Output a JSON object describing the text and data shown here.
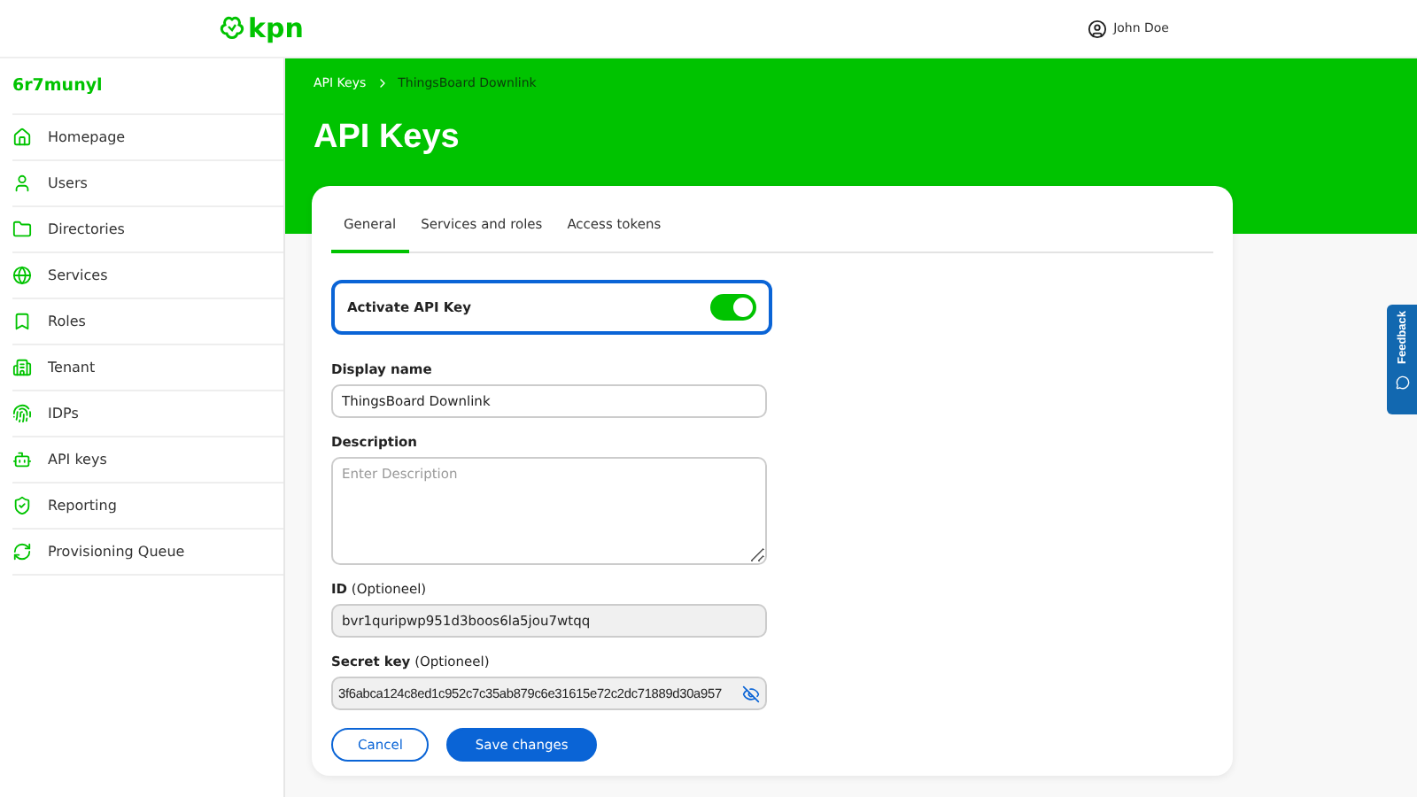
{
  "header": {
    "logo": "kpn",
    "user": "John Doe"
  },
  "sidebar": {
    "title": "6r7munyl",
    "items": [
      {
        "label": "Homepage",
        "selected": false
      },
      {
        "label": "Users",
        "selected": false
      },
      {
        "label": "Directories",
        "selected": false
      },
      {
        "label": "Services",
        "selected": false
      },
      {
        "label": "Roles",
        "selected": false
      },
      {
        "label": "Tenant",
        "selected": false
      },
      {
        "label": "IDPs",
        "selected": false
      },
      {
        "label": "API keys",
        "selected": false
      },
      {
        "label": "Reporting",
        "selected": false
      },
      {
        "label": "Provisioning Queue",
        "selected": false
      }
    ]
  },
  "breadcrumb": [
    {
      "label": "API Keys"
    },
    {
      "label": "ThingsBoard Downlink"
    }
  ],
  "title": "API Keys",
  "tabs": [
    {
      "label": "General",
      "selected": true
    },
    {
      "label": "Services and roles",
      "selected": false
    },
    {
      "label": "Access tokens",
      "selected": false
    }
  ],
  "activate": {
    "label": "Activate API Key",
    "on": true
  },
  "fields": [
    {
      "kind": "text",
      "label": "Display name",
      "value": "ThingsBoard Downlink"
    },
    {
      "kind": "textarea",
      "label": "Description",
      "placeholder": "Enter Description"
    },
    {
      "kind": "readonly",
      "label": "ID",
      "hint": "(Optioneel)",
      "value": "bvr1quripwp951d3boos6la5jou7wtqq"
    },
    {
      "kind": "secret",
      "label": "Secret key",
      "hint": "(Optioneel)",
      "value": "3f6abca124c8ed1c952c7c35ab879c6e31615e72c2dc71889d30a957"
    }
  ],
  "buttons": [
    {
      "label": "Cancel",
      "kind": "secondary"
    },
    {
      "label": "Save changes",
      "kind": "primary"
    }
  ],
  "feedback": "Feedback"
}
